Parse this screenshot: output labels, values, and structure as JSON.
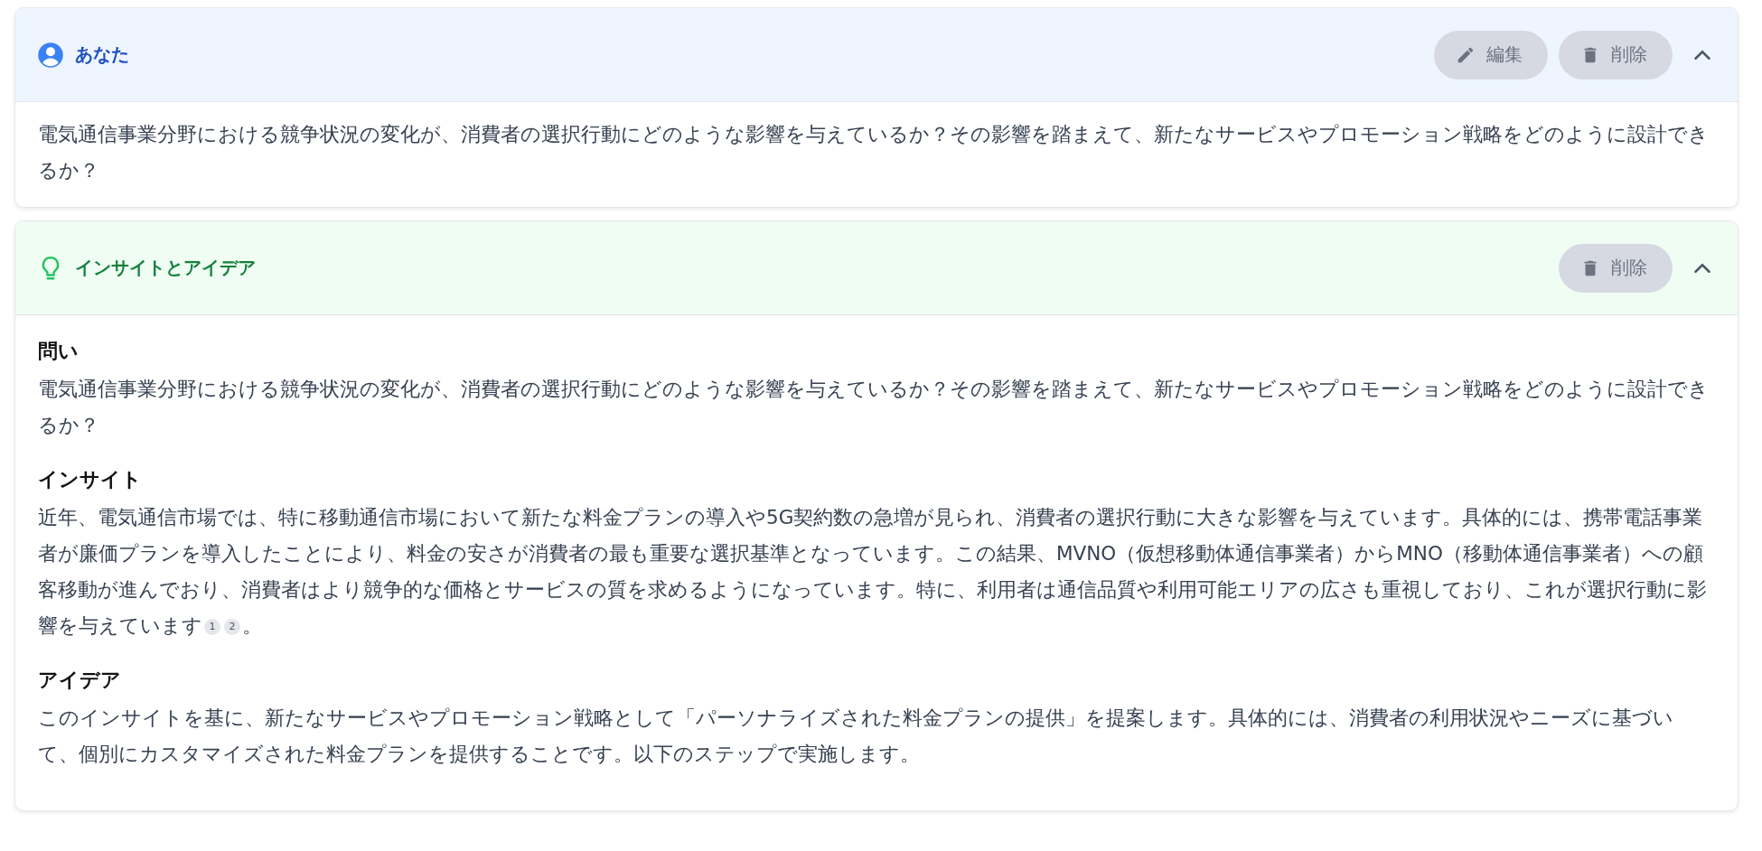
{
  "messages": [
    {
      "kind": "user",
      "author": "あなた",
      "expanded": true,
      "actions": [
        {
          "kind": "edit",
          "label": "編集"
        },
        {
          "kind": "delete",
          "label": "削除"
        }
      ],
      "text": "電気通信事業分野における競争状況の変化が、消費者の選択行動にどのような影響を与えているか？その影響を踏まえて、新たなサービスやプロモーション戦略をどのように設計できるか？"
    },
    {
      "kind": "insight",
      "author": "インサイトとアイデア",
      "expanded": true,
      "actions": [
        {
          "kind": "delete",
          "label": "削除"
        }
      ],
      "sections": [
        {
          "heading": "問い",
          "text": "電気通信事業分野における競争状況の変化が、消費者の選択行動にどのような影響を与えているか？その影響を踏まえて、新たなサービスやプロモーション戦略をどのように設計できるか？"
        },
        {
          "heading": "インサイト",
          "text": "近年、電気通信市場では、特に移動通信市場において新たな料金プランの導入や5G契約数の急増が見られ、消費者の選択行動に大きな影響を与えています。具体的には、携帯電話事業者が廉価プランを導入したことにより、料金の安さが消費者の最も重要な選択基準となっています。この結果、MVNO（仮想移動体通信事業者）からMNO（移動体通信事業者）への顧客移動が進んでおり、消費者はより競争的な価格とサービスの質を求めるようになっています。特に、利用者は通信品質や利用可能エリアの広さも重視しており、これが選択行動に影響を与えています",
          "citations": [
            "1",
            "2"
          ],
          "tail": "。"
        },
        {
          "heading": "アイデア",
          "text": "このインサイトを基に、新たなサービスやプロモーション戦略として「パーソナライズされた料金プランの提供」を提案します。具体的には、消費者の利用状況やニーズに基づいて、個別にカスタマイズされた料金プランを提供することです。以下のステップで実施します。"
        }
      ]
    }
  ]
}
